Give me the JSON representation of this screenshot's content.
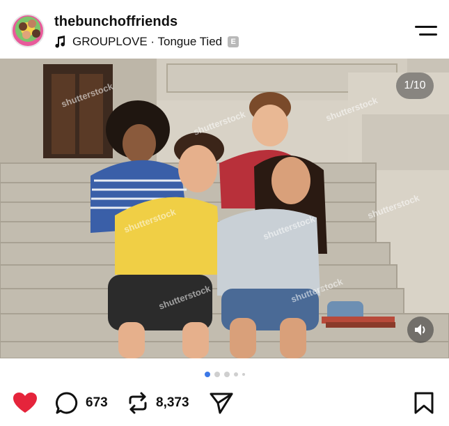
{
  "post": {
    "username": "thebunchoffriends",
    "music_artist_track": "GROUPLOVE · Tongue Tied",
    "explicit_badge": "E",
    "avatar_icon": "group-photo-avatar",
    "menu_icon": "menu-icon"
  },
  "media": {
    "counter": "1/10",
    "current_index": 1,
    "total": 10,
    "watermark": "shutterstock",
    "sound_icon": "speaker-icon"
  },
  "actions": {
    "like_icon": "heart-filled-icon",
    "comment_icon": "comment-icon",
    "comment_count": "673",
    "repost_icon": "repost-icon",
    "repost_count": "8,373",
    "share_icon": "send-icon",
    "save_icon": "bookmark-icon"
  },
  "colors": {
    "like": "#e5243b",
    "dot_active": "#3b78e7",
    "dot_inactive": "#cfcfcf"
  }
}
